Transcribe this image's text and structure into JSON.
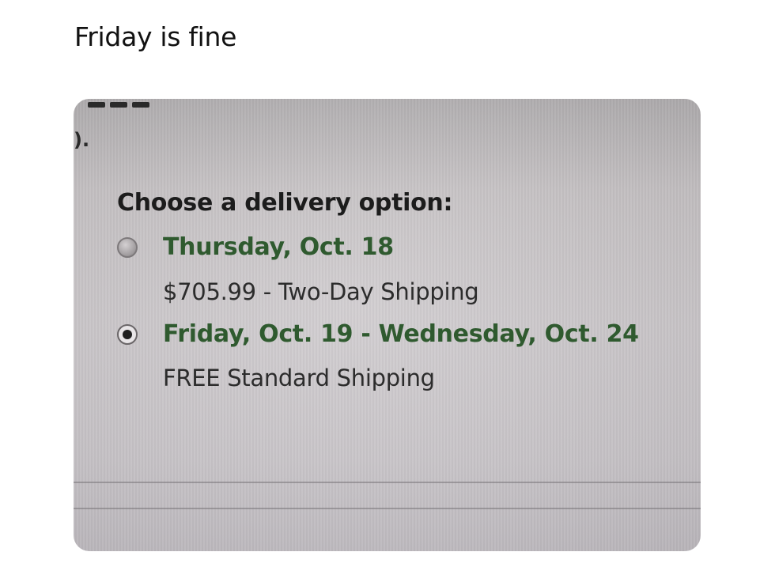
{
  "post": {
    "caption": "Friday is fine"
  },
  "screenshot": {
    "left_fragment": ").",
    "heading": "Choose a delivery option:",
    "options": [
      {
        "title": "Thursday, Oct. 18",
        "subtitle": "$705.99 - Two-Day Shipping",
        "selected": false
      },
      {
        "title": "Friday, Oct. 19 - Wednesday, Oct. 24",
        "subtitle": "FREE Standard Shipping",
        "selected": true
      }
    ],
    "colors": {
      "option_title": "#2f5a2f",
      "heading": "#1c1c1c",
      "photo_background": "#cbc7cb"
    }
  }
}
